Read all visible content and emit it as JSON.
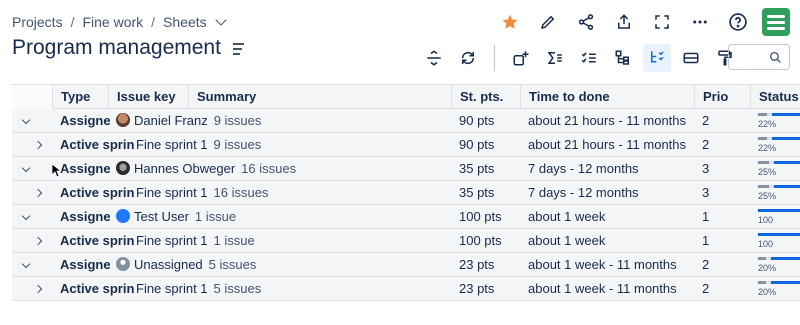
{
  "breadcrumb": {
    "items": [
      "Projects",
      "Fine work",
      "Sheets"
    ]
  },
  "page_title": "Program management",
  "columns": [
    "Type",
    "Issue key",
    "Summary",
    "St. pts.",
    "Time to done",
    "Prio",
    "Status"
  ],
  "rows": [
    {
      "kind": "group",
      "type": "Assignee",
      "name": "Daniel Franz",
      "count": "9 issues",
      "pts": "90 pts",
      "time": "about 21 hours - 11 months",
      "prio": "2",
      "status_pct": "22%",
      "status_fraction": 0.22,
      "avatar": "photo"
    },
    {
      "kind": "sub",
      "type": "Active sprint",
      "name": "Fine sprint 1",
      "count": "9 issues",
      "pts": "90 pts",
      "time": "about 21 hours - 11 months",
      "prio": "2",
      "status_pct": "22%",
      "status_fraction": 0.22
    },
    {
      "kind": "group",
      "type": "Assignee",
      "name": "Hannes Obweger",
      "count": "16 issues",
      "pts": "35 pts",
      "time": "7 days - 12 months",
      "prio": "3",
      "status_pct": "25%",
      "status_fraction": 0.25,
      "avatar": "photo-dark"
    },
    {
      "kind": "sub",
      "type": "Active sprint",
      "name": "Fine sprint 1",
      "count": "16 issues",
      "pts": "35 pts",
      "time": "7 days - 12 months",
      "prio": "3",
      "status_pct": "25%",
      "status_fraction": 0.25
    },
    {
      "kind": "group",
      "type": "Assignee",
      "name": "Test User",
      "count": "1 issue",
      "pts": "100 pts",
      "time": "about 1 week",
      "prio": "1",
      "status_pct": "100",
      "status_fraction": 1.0,
      "avatar": "blue"
    },
    {
      "kind": "sub",
      "type": "Active sprint",
      "name": "Fine sprint 1",
      "count": "1 issue",
      "pts": "100 pts",
      "time": "about 1 week",
      "prio": "1",
      "status_pct": "100",
      "status_fraction": 1.0
    },
    {
      "kind": "group",
      "type": "Assignee",
      "name": "Unassigned",
      "count": "5 issues",
      "pts": "23 pts",
      "time": "about 1 week - 11 months",
      "prio": "2",
      "status_pct": "20%",
      "status_fraction": 0.2,
      "avatar": "generic"
    },
    {
      "kind": "sub",
      "type": "Active sprint",
      "name": "Fine sprint 1",
      "count": "5 issues",
      "pts": "23 pts",
      "time": "about 1 week - 11 months",
      "prio": "2",
      "status_pct": "20%",
      "status_fraction": 0.2
    }
  ],
  "colors": {
    "logo": "#2e9f5c",
    "star": "#f18d42",
    "active_tool": "#e9f2ff",
    "progress_blue": "#0c66e4",
    "progress_gray": "#8590a2"
  }
}
